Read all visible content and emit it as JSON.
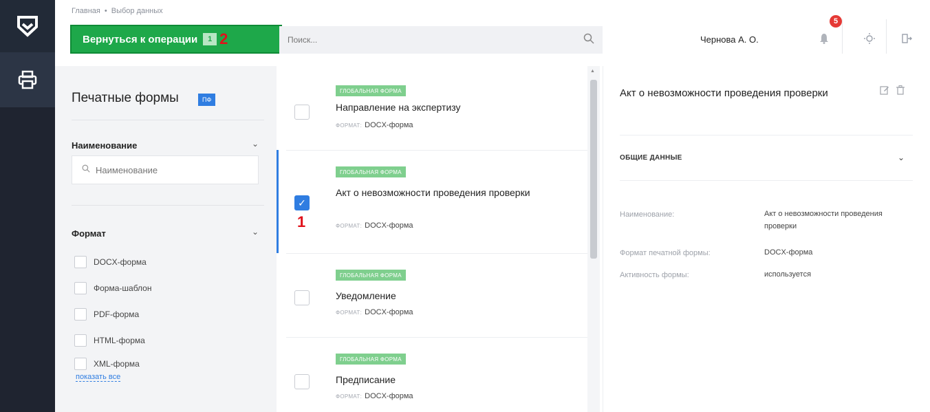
{
  "header": {
    "breadcrumb": [
      "Главная",
      "Выбор данных"
    ],
    "breadcrumb_sep": "•",
    "back_button": {
      "label": "Вернуться к операции",
      "badge": "1",
      "annotation": "2"
    },
    "search": {
      "placeholder": "Поиск..."
    },
    "user_name": "Чернова А. О.",
    "notifications_count": "5"
  },
  "filters": {
    "title": "Печатные формы",
    "tag": "ПФ",
    "name_section": {
      "title": "Наименование",
      "placeholder": "Наименование"
    },
    "format_section": {
      "title": "Формат",
      "options": [
        "DOCX-форма",
        "Форма-шаблон",
        "PDF-форма",
        "HTML-форма",
        "XML-форма"
      ],
      "show_all": "показать все"
    }
  },
  "list": {
    "format_label": "ФОРМАТ:",
    "items": [
      {
        "tag": "ГЛОБАЛЬНАЯ ФОРМА",
        "title": "Направление на экспертизу",
        "format": "DOCX-форма",
        "checked": false
      },
      {
        "tag": "ГЛОБАЛЬНАЯ ФОРМА",
        "title": "Акт о невозможности проведения проверки",
        "format": "DOCX-форма",
        "checked": true,
        "annotation": "1"
      },
      {
        "tag": "ГЛОБАЛЬНАЯ ФОРМА",
        "title": "Уведомление",
        "format": "DOCX-форма",
        "checked": false
      },
      {
        "tag": "ГЛОБАЛЬНАЯ ФОРМА",
        "title": "Предписание",
        "format": "DOCX-форма",
        "checked": false
      }
    ]
  },
  "detail": {
    "title": "Акт о невозможности проведения проверки",
    "section": "ОБЩИЕ ДАННЫЕ",
    "fields": [
      {
        "label": "Наименование:",
        "value": "Акт о невозможности проведения проверки"
      },
      {
        "label": "Формат печатной формы:",
        "value": "DOCX-форма"
      },
      {
        "label": "Активность формы:",
        "value": "используется"
      }
    ]
  },
  "colors": {
    "accent": "#2f7de1",
    "success": "#1ea84a",
    "tag": "#7fcf8e",
    "danger": "#e53935",
    "rail": "#1f2430"
  }
}
